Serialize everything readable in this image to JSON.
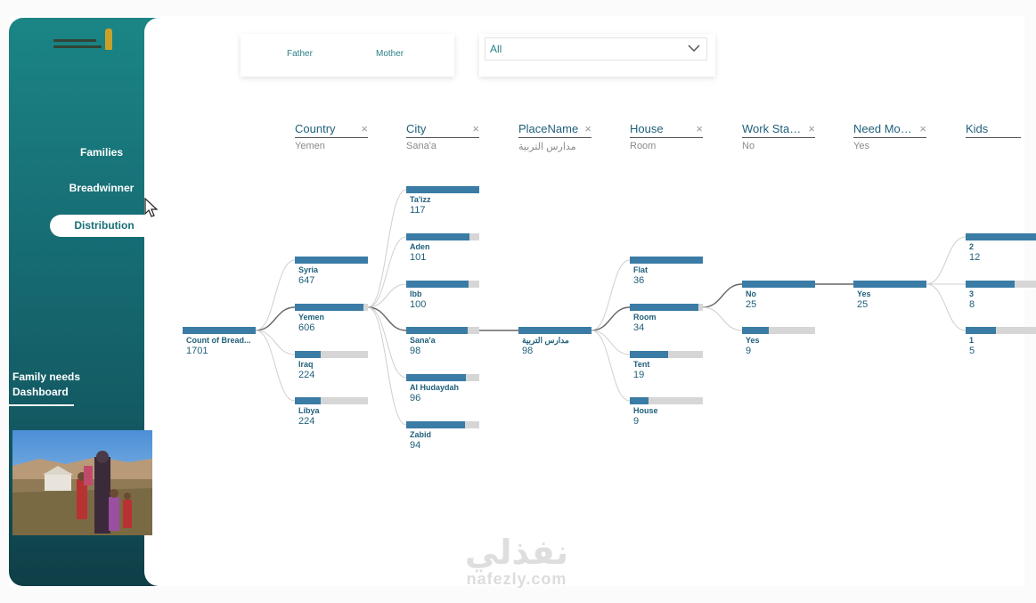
{
  "sidebar": {
    "nav": {
      "families": "Families",
      "breadwinner": "Breadwinner",
      "distribution": "Distribution"
    },
    "dashboard_title_line1": "Family needs",
    "dashboard_title_line2": "Dashboard"
  },
  "slicer": {
    "option_father": "Father",
    "option_mother": "Mother"
  },
  "dropdown": {
    "value": "All"
  },
  "levels": [
    {
      "title": "Country",
      "selected": "Yemen"
    },
    {
      "title": "City",
      "selected": "Sana'a"
    },
    {
      "title": "PlaceName",
      "selected": "مدارس التربية"
    },
    {
      "title": "House",
      "selected": "Room"
    },
    {
      "title": "Work Status",
      "selected": "No"
    },
    {
      "title": "Need Mon...",
      "selected": "Yes"
    },
    {
      "title": "Kids",
      "selected": ""
    }
  ],
  "tree": {
    "root": {
      "label": "Count of Bread...",
      "value": "1701"
    },
    "country": [
      {
        "label": "Syria",
        "value": "647",
        "ratio": 1.0
      },
      {
        "label": "Yemen",
        "value": "606",
        "ratio": 0.94
      },
      {
        "label": "Iraq",
        "value": "224",
        "ratio": 0.35
      },
      {
        "label": "Libya",
        "value": "224",
        "ratio": 0.35
      }
    ],
    "city": [
      {
        "label": "Ta'izz",
        "value": "117",
        "ratio": 1.0
      },
      {
        "label": "Aden",
        "value": "101",
        "ratio": 0.86
      },
      {
        "label": "Ibb",
        "value": "100",
        "ratio": 0.85
      },
      {
        "label": "Sana'a",
        "value": "98",
        "ratio": 0.84
      },
      {
        "label": "Al Hudaydah",
        "value": "96",
        "ratio": 0.82
      },
      {
        "label": "Zabid",
        "value": "94",
        "ratio": 0.8
      }
    ],
    "place": [
      {
        "label": "مدارس التربية",
        "value": "98",
        "ratio": 1.0
      }
    ],
    "house": [
      {
        "label": "Flat",
        "value": "36",
        "ratio": 1.0
      },
      {
        "label": "Room",
        "value": "34",
        "ratio": 0.94
      },
      {
        "label": "Tent",
        "value": "19",
        "ratio": 0.53
      },
      {
        "label": "House",
        "value": "9",
        "ratio": 0.25
      }
    ],
    "work": [
      {
        "label": "No",
        "value": "25",
        "ratio": 1.0
      },
      {
        "label": "Yes",
        "value": "9",
        "ratio": 0.36
      }
    ],
    "need": [
      {
        "label": "Yes",
        "value": "25",
        "ratio": 1.0
      }
    ],
    "kids": [
      {
        "label": "2",
        "value": "12",
        "ratio": 1.0
      },
      {
        "label": "3",
        "value": "8",
        "ratio": 0.67
      },
      {
        "label": "1",
        "value": "5",
        "ratio": 0.42
      }
    ]
  },
  "watermark": {
    "arabic": "نفذلي",
    "latin": "nafezly.com"
  },
  "colors": {
    "accent": "#3a7ca5",
    "bar_bg": "#d6d6d6",
    "sidebar_top": "#1b8585",
    "sidebar_bottom": "#0f3e47"
  }
}
